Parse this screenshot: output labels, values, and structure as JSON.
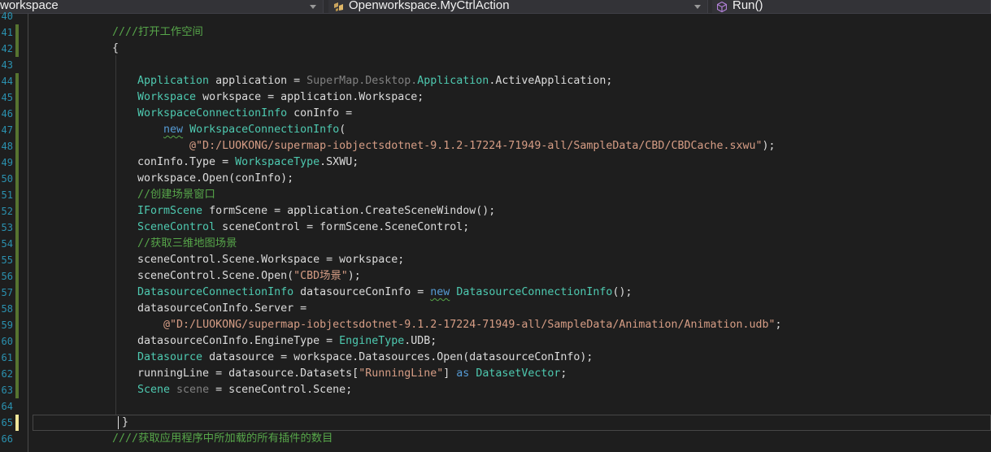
{
  "navbar": {
    "project_label": "workspace",
    "class_label": "Openworkspace.MyCtrlAction",
    "member_label": "Run()"
  },
  "editor": {
    "lines": [
      {
        "num": "40",
        "change": "none",
        "tokens": []
      },
      {
        "num": "41",
        "change": "saved",
        "tokens": [
          {
            "t": "////打开工作空间",
            "c": "c-cm"
          }
        ]
      },
      {
        "num": "42",
        "change": "saved",
        "tokens": [
          {
            "t": "{",
            "c": ""
          }
        ]
      },
      {
        "num": "43",
        "change": "none",
        "tokens": []
      },
      {
        "num": "44",
        "change": "saved",
        "tokens": [
          {
            "t": "Application",
            "c": "c-ty"
          },
          {
            "t": " application = ",
            "c": ""
          },
          {
            "t": "SuperMap.Desktop.",
            "c": "c-gr"
          },
          {
            "t": "Application",
            "c": "c-ty"
          },
          {
            "t": ".ActiveApplication;",
            "c": ""
          }
        ]
      },
      {
        "num": "45",
        "change": "saved",
        "tokens": [
          {
            "t": "Workspace",
            "c": "c-ty"
          },
          {
            "t": " workspace = application.Workspace;",
            "c": ""
          }
        ]
      },
      {
        "num": "46",
        "change": "saved",
        "tokens": [
          {
            "t": "WorkspaceConnectionInfo",
            "c": "c-ty"
          },
          {
            "t": " conInfo =",
            "c": ""
          }
        ]
      },
      {
        "num": "47",
        "change": "saved",
        "tokens": [
          {
            "t": "    ",
            "c": ""
          },
          {
            "t": "new",
            "c": "c-kw squig"
          },
          {
            "t": " ",
            "c": ""
          },
          {
            "t": "WorkspaceConnectionInfo",
            "c": "c-ty"
          },
          {
            "t": "(",
            "c": ""
          }
        ]
      },
      {
        "num": "48",
        "change": "saved",
        "tokens": [
          {
            "t": "        ",
            "c": ""
          },
          {
            "t": "@\"D:/LUOKONG/supermap-iobjectsdotnet-9.1.2-17224-71949-all/SampleData/CBD/CBDCache.sxwu\"",
            "c": "c-st"
          },
          {
            "t": ");",
            "c": ""
          }
        ]
      },
      {
        "num": "49",
        "change": "saved",
        "tokens": [
          {
            "t": "conInfo.Type = ",
            "c": ""
          },
          {
            "t": "WorkspaceType",
            "c": "c-ty"
          },
          {
            "t": ".SXWU;",
            "c": ""
          }
        ]
      },
      {
        "num": "50",
        "change": "saved",
        "tokens": [
          {
            "t": "workspace.Open(conInfo);",
            "c": ""
          }
        ]
      },
      {
        "num": "51",
        "change": "saved",
        "tokens": [
          {
            "t": "//创建场景窗口",
            "c": "c-cm"
          }
        ]
      },
      {
        "num": "52",
        "change": "saved",
        "tokens": [
          {
            "t": "IFormScene",
            "c": "c-ty"
          },
          {
            "t": " formScene = application.CreateSceneWindow();",
            "c": ""
          }
        ]
      },
      {
        "num": "53",
        "change": "saved",
        "tokens": [
          {
            "t": "SceneControl",
            "c": "c-ty"
          },
          {
            "t": " sceneControl = formScene.SceneControl;",
            "c": ""
          }
        ]
      },
      {
        "num": "54",
        "change": "saved",
        "tokens": [
          {
            "t": "//获取三维地图场景",
            "c": "c-cm"
          }
        ]
      },
      {
        "num": "55",
        "change": "saved",
        "tokens": [
          {
            "t": "sceneControl.Scene.Workspace = workspace;",
            "c": ""
          }
        ]
      },
      {
        "num": "56",
        "change": "saved",
        "tokens": [
          {
            "t": "sceneControl.Scene.Open(",
            "c": ""
          },
          {
            "t": "\"CBD场景\"",
            "c": "c-st"
          },
          {
            "t": ");",
            "c": ""
          }
        ]
      },
      {
        "num": "57",
        "change": "saved",
        "tokens": [
          {
            "t": "DatasourceConnectionInfo",
            "c": "c-ty"
          },
          {
            "t": " datasourceConInfo = ",
            "c": ""
          },
          {
            "t": "new",
            "c": "c-kw squig"
          },
          {
            "t": " ",
            "c": ""
          },
          {
            "t": "DatasourceConnectionInfo",
            "c": "c-ty"
          },
          {
            "t": "();",
            "c": ""
          }
        ]
      },
      {
        "num": "58",
        "change": "saved",
        "tokens": [
          {
            "t": "datasourceConInfo.Server =",
            "c": ""
          }
        ]
      },
      {
        "num": "59",
        "change": "saved",
        "tokens": [
          {
            "t": "    ",
            "c": ""
          },
          {
            "t": "@\"D:/LUOKONG/supermap-iobjectsdotnet-9.1.2-17224-71949-all/SampleData/Animation/Animation.udb\"",
            "c": "c-st"
          },
          {
            "t": ";",
            "c": ""
          }
        ]
      },
      {
        "num": "60",
        "change": "saved",
        "tokens": [
          {
            "t": "datasourceConInfo.EngineType = ",
            "c": ""
          },
          {
            "t": "EngineType",
            "c": "c-ty"
          },
          {
            "t": ".UDB;",
            "c": ""
          }
        ]
      },
      {
        "num": "61",
        "change": "saved",
        "tokens": [
          {
            "t": "Datasource",
            "c": "c-ty"
          },
          {
            "t": " datasource = workspace.Datasources.Open(datasourceConInfo);",
            "c": ""
          }
        ]
      },
      {
        "num": "62",
        "change": "saved",
        "tokens": [
          {
            "t": "runningLine = datasource.Datasets[",
            "c": ""
          },
          {
            "t": "\"RunningLine\"",
            "c": "c-st"
          },
          {
            "t": "] ",
            "c": ""
          },
          {
            "t": "as",
            "c": "c-kw"
          },
          {
            "t": " ",
            "c": ""
          },
          {
            "t": "DatasetVector",
            "c": "c-ty"
          },
          {
            "t": ";",
            "c": ""
          }
        ]
      },
      {
        "num": "63",
        "change": "saved",
        "tokens": [
          {
            "t": "Scene",
            "c": "c-ty"
          },
          {
            "t": " ",
            "c": ""
          },
          {
            "t": "scene",
            "c": "c-gr"
          },
          {
            "t": " = sceneControl.Scene;",
            "c": ""
          }
        ]
      },
      {
        "num": "64",
        "change": "none",
        "tokens": []
      },
      {
        "num": "65",
        "change": "unsaved",
        "tokens": [
          {
            "t": "}",
            "c": ""
          }
        ]
      },
      {
        "num": "66",
        "change": "none",
        "tokens": [
          {
            "t": "////获取应用程序中所加载的所有插件的数目",
            "c": "c-cm"
          }
        ]
      }
    ]
  },
  "colors": {
    "editor_bg": "#1e1e1e",
    "comment": "#57a64a",
    "keyword": "#569cd6",
    "type": "#4ec9b0",
    "string": "#d69d85",
    "line_number": "#2b91af"
  }
}
